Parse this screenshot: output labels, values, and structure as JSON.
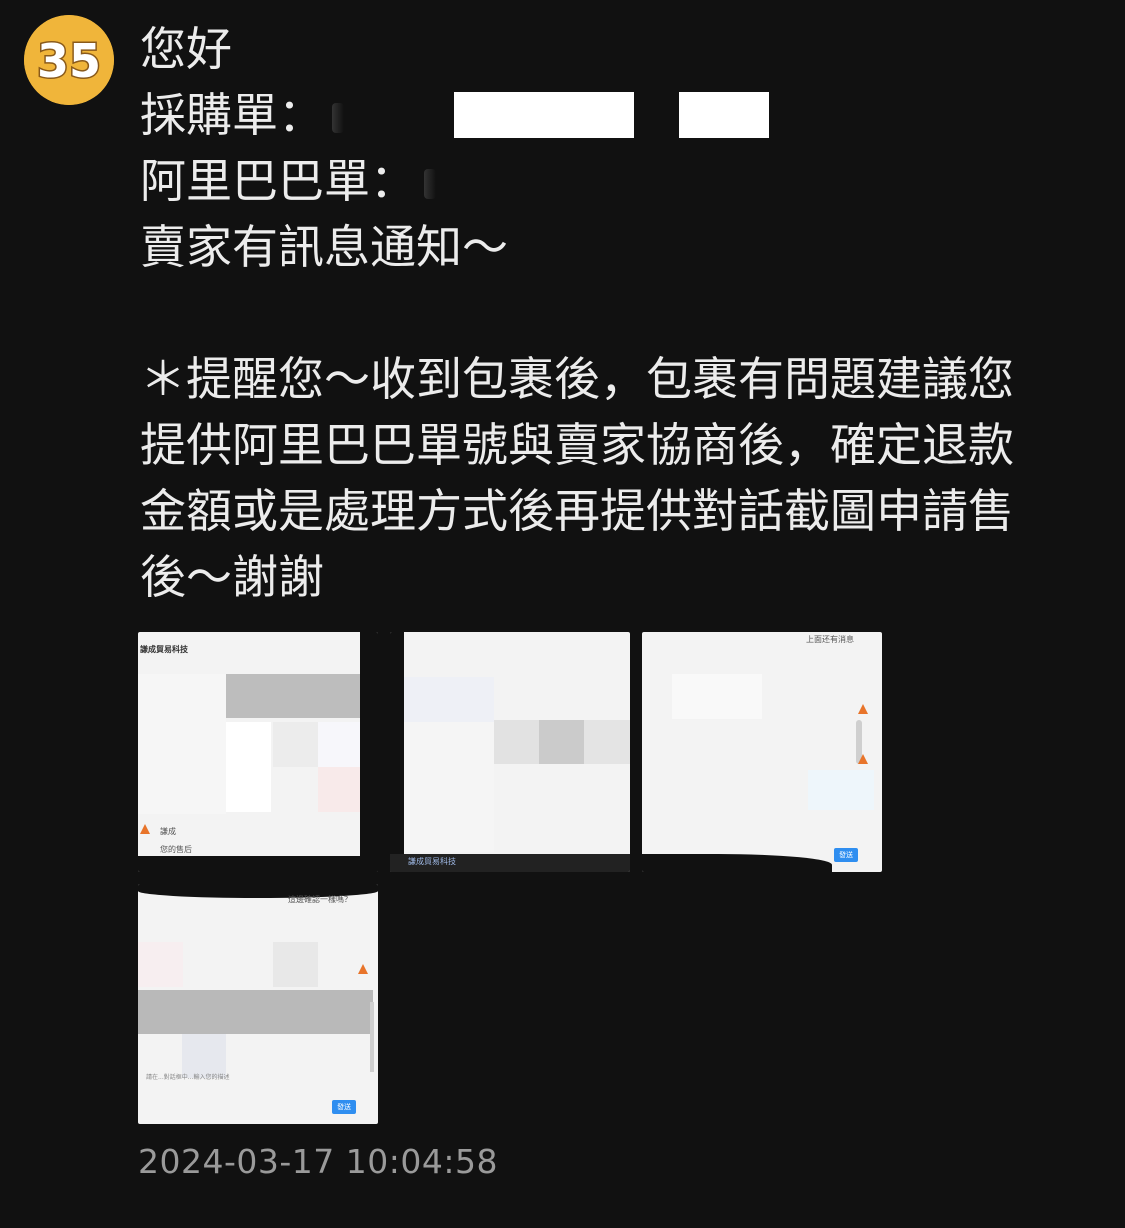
{
  "avatar": {
    "text": "35",
    "bg_color": "#f0b53a",
    "icon": "shop-logo-avatar"
  },
  "message": {
    "greeting": "您好",
    "purchase_label": "採購單：",
    "alibaba_label": "阿里巴巴單：",
    "seller_notice": "賣家有訊息通知～",
    "reminder_lines": [
      "＊提醒您～收到包裹後，包裹有問題建議您",
      "提供阿里巴巴單號與賣家協商後，確定退款",
      "金額或是處理方式後再提供對話截圖申請售",
      "後～謝謝"
    ]
  },
  "attachments": {
    "t1_title": "謙成貿易科技",
    "t1_msg1": "謙成",
    "t1_msg2": "您的售后",
    "t2_footer": "謙成貿易科技",
    "t3_header": "上面还有消息",
    "t3_btn": "發送",
    "t4_header": "這邊確認一樣嗎？",
    "t4_input": "請在...對話框中...輸入您的描述",
    "t4_btn": "發送"
  },
  "timestamp": "2024-03-17 10:04:58",
  "colors": {
    "background": "#111111",
    "text": "#ececec",
    "timestamp": "#9a9a9a",
    "accent_blue": "#2f8ef0"
  }
}
